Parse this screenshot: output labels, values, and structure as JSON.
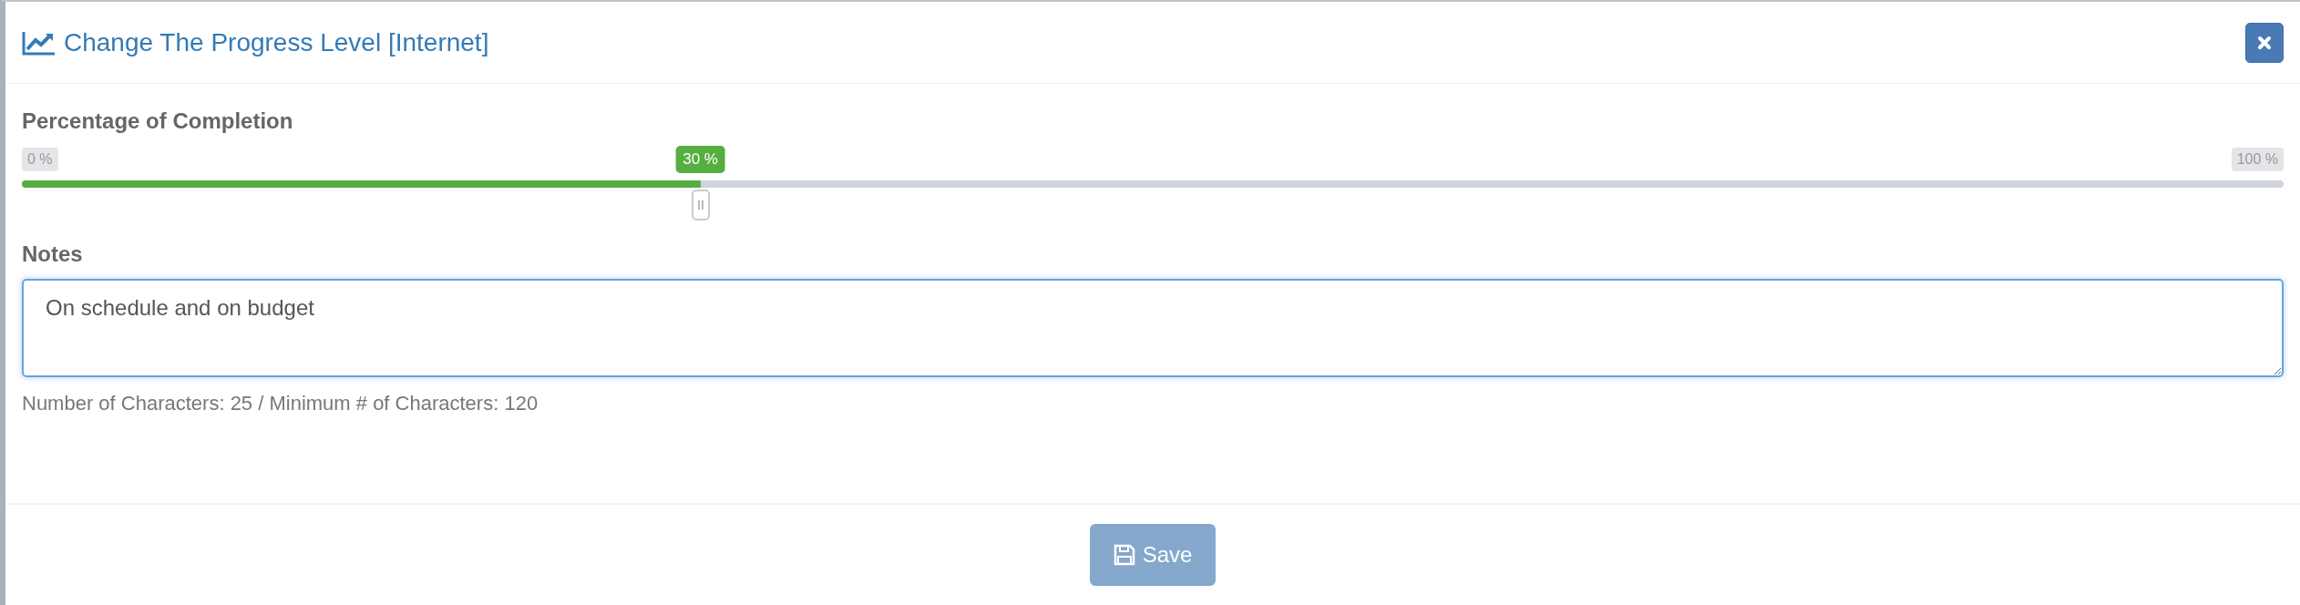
{
  "dialog": {
    "title": "Change The Progress Level [Internet]"
  },
  "progress": {
    "label": "Percentage of Completion",
    "min_label": "0 %",
    "max_label": "100 %",
    "value_label": "30 %",
    "level": 0.3
  },
  "notes": {
    "label": "Notes",
    "value": "On schedule and on budget",
    "count_text": "Number of Characters: 25 / Minimum # of Characters: 120"
  },
  "save_button": {
    "label": "Save",
    "disabled": true
  }
}
